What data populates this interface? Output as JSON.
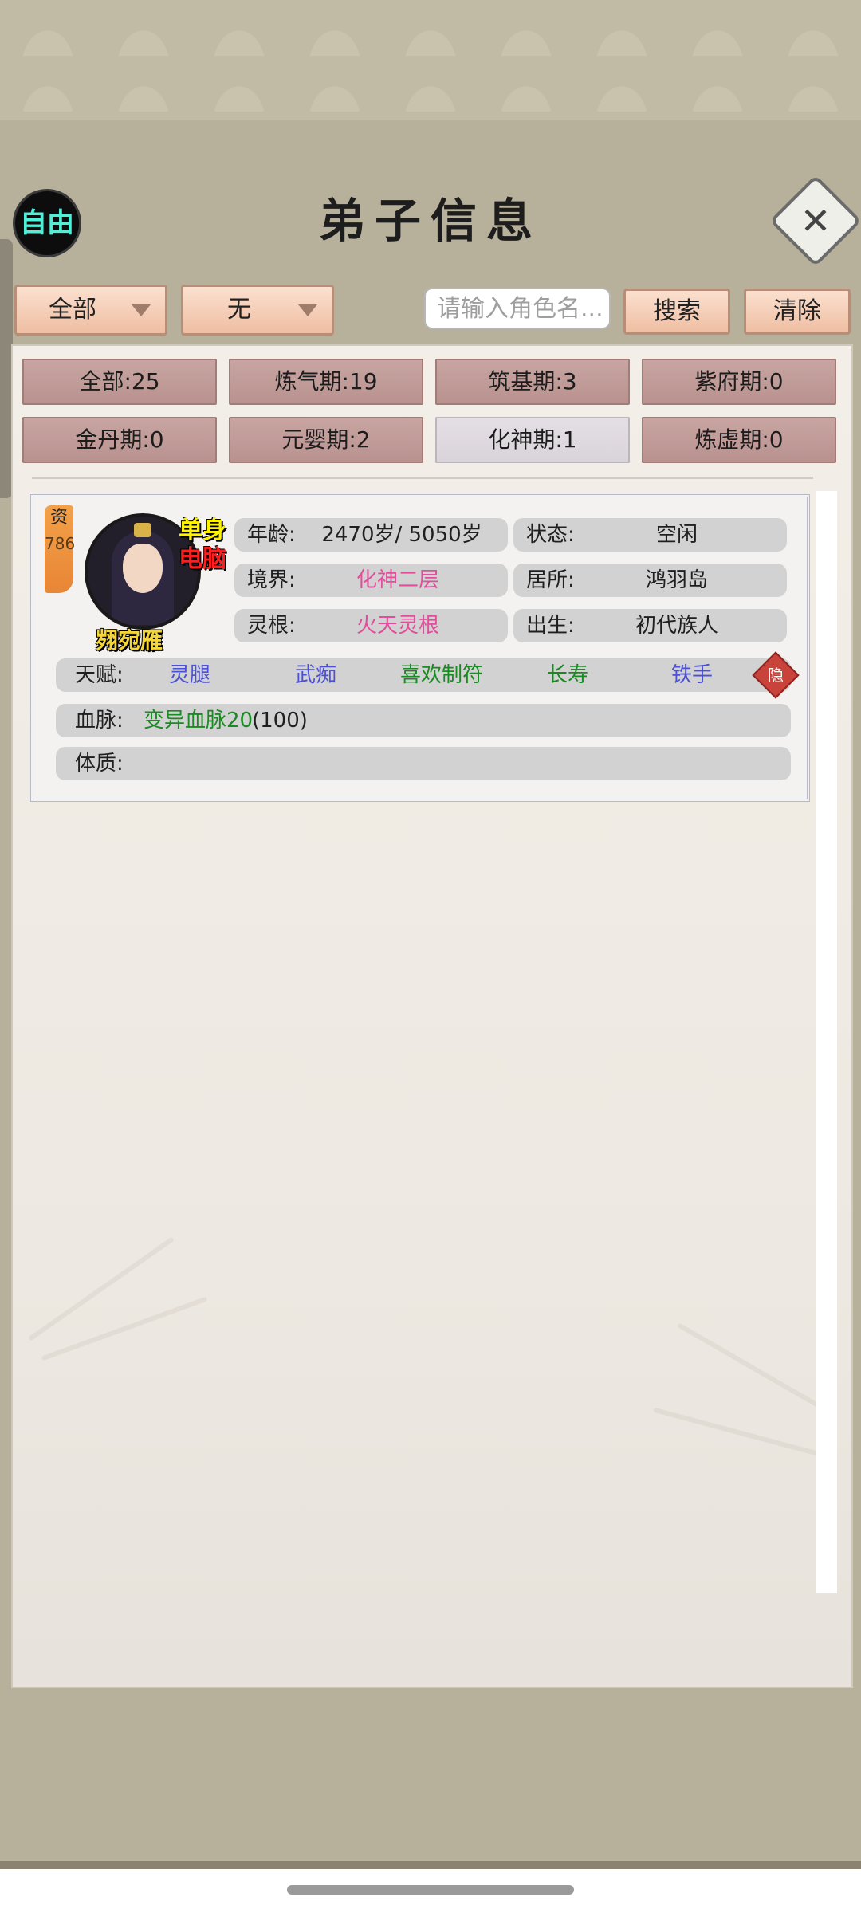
{
  "header": {
    "free_label": "自由",
    "title": "弟子信息",
    "close_symbol": "✕"
  },
  "filters": {
    "category_dropdown": "全部",
    "type_dropdown": "无",
    "search_placeholder": "请输入角色名...",
    "search_button": "搜索",
    "clear_button": "清除"
  },
  "realm_filters": [
    {
      "label": "全部:25",
      "selected": false
    },
    {
      "label": "炼气期:19",
      "selected": false
    },
    {
      "label": "筑基期:3",
      "selected": false
    },
    {
      "label": "紫府期:0",
      "selected": false
    },
    {
      "label": "金丹期:0",
      "selected": false
    },
    {
      "label": "元婴期:2",
      "selected": false
    },
    {
      "label": "化神期:1",
      "selected": true
    },
    {
      "label": "炼虚期:0",
      "selected": false
    }
  ],
  "disciple": {
    "aptitude_label": "资",
    "aptitude_value": "786",
    "tag_single": "单身",
    "tag_ai": "电脑",
    "name": "翙宛雁",
    "age_label": "年龄:",
    "age_value": "2470岁/ 5050岁",
    "status_label": "状态:",
    "status_value": "空闲",
    "realm_label": "境界:",
    "realm_value": "化神二层",
    "residence_label": "居所:",
    "residence_value": "鸿羽岛",
    "root_label": "灵根:",
    "root_value": "火天灵根",
    "birth_label": "出生:",
    "birth_value": "初代族人",
    "talent_label": "天赋:",
    "talents": [
      "灵腿",
      "武痴",
      "喜欢制符",
      "长寿",
      "铁手"
    ],
    "hide_label": "隐",
    "bloodline_label": "血脉:",
    "bloodline_value": "变异血脉20",
    "bloodline_extra": "(100)",
    "physique_label": "体质:"
  },
  "colors": {
    "talent_blue": "#4b50d6",
    "talent_green": "#1a8a22",
    "highlight_pink": "#e44c9c"
  }
}
